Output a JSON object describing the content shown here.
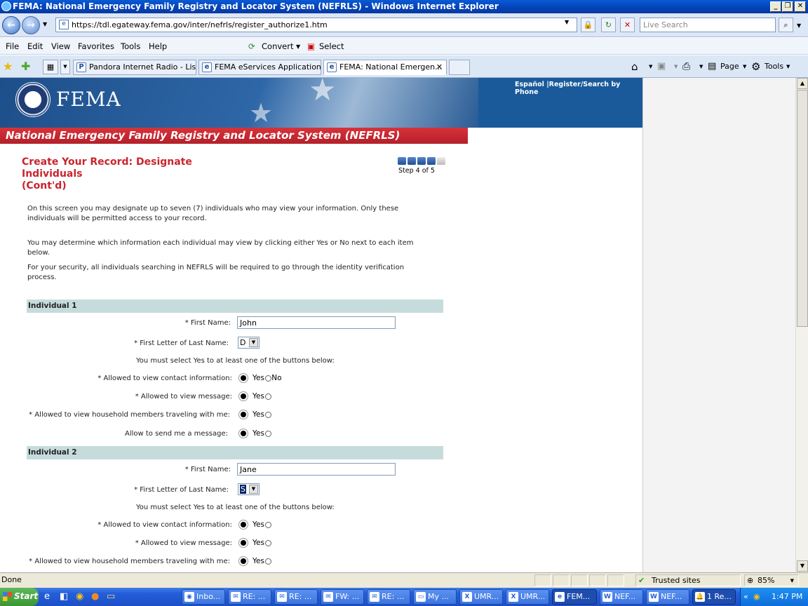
{
  "window": {
    "title": "FEMA: National Emergency Family Registry and Locator System (NEFRLS) - Windows Internet Explorer"
  },
  "addressbar": {
    "url": "https://tdl.egateway.fema.gov/inter/nefrls/register_authorize1.htm",
    "search_placeholder": "Live Search"
  },
  "menu": {
    "items": [
      "File",
      "Edit",
      "View",
      "Favorites",
      "Tools",
      "Help"
    ],
    "convert": "Convert",
    "select": "Select"
  },
  "tabs": [
    {
      "label": "Pandora Internet Radio - Lis..."
    },
    {
      "label": "FEMA eServices Application ..."
    },
    {
      "label": "FEMA: National Emergen..."
    }
  ],
  "toolbar": {
    "page": "Page",
    "tools": "Tools"
  },
  "page": {
    "logo": "FEMA",
    "top_links": "Español |Register/Search by Phone",
    "system_name": "National Emergency Family Registry and Locator System  (NEFRLS)",
    "title_line1": "Create Your Record: Designate Individuals",
    "title_line2": "(Cont'd)",
    "step_label": "Step 4 of 5",
    "para1": "On this screen you may designate up to seven (7) individuals who may view your information. Only these individuals will be permitted access to your record.",
    "para2": "You may determine which information each individual may view by clicking either Yes or No next to each item below.",
    "para3": "For your security, all individuals searching in NEFRLS will be required to go through the identity verification process.",
    "must_select": "You must select Yes to at least one of the buttons below:",
    "labels": {
      "first_name": "* First Name:",
      "last_initial": "* First Letter of Last Name:",
      "contact": "* Allowed to view contact information:",
      "message": "* Allowed to view message:",
      "household": "* Allowed to view household members traveling with me:",
      "send_message": "Allow to send me a message:"
    },
    "yes": "Yes",
    "no": "No",
    "individual1": {
      "header": "Individual 1",
      "first_name": "John",
      "last_initial": "D"
    },
    "individual2": {
      "header": "Individual 2",
      "first_name": "Jane",
      "last_initial": "S"
    }
  },
  "statusbar": {
    "status": "Done",
    "zone": "Trusted sites",
    "zoom": "85%"
  },
  "taskbar": {
    "start": "Start",
    "tasks": [
      "Inbo...",
      "RE: ...",
      "RE: ...",
      "FW: ...",
      "RE: ...",
      "My ...",
      "UMR...",
      "UMR...",
      "FEM...",
      "NEF...",
      "NEF...",
      "1 Re..."
    ],
    "clock": "1:47 PM"
  }
}
